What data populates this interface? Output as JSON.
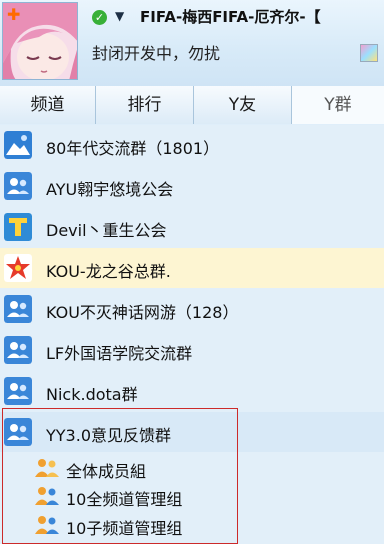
{
  "header": {
    "nickname": "FIFA-梅西FIFA-厄齐尔-【",
    "signature": "封闭开发中，勿扰",
    "status_icon": "online-check-icon",
    "colors": {
      "status_online": "#38b038",
      "accent_plus": "#ff6a00"
    }
  },
  "tabs": [
    {
      "label": "频道"
    },
    {
      "label": "排行"
    },
    {
      "label": "Y友"
    },
    {
      "label": "Y群"
    }
  ],
  "groups": [
    {
      "name": "80年代交流群（1801）",
      "icon": "group-icon-blue"
    },
    {
      "name": "AYU翱宇悠境公会",
      "icon": "people-icon"
    },
    {
      "name": "Devil丶重生公会",
      "icon": "guild-icon"
    },
    {
      "name": "KOU-龙之谷总群.",
      "icon": "star-group-icon"
    },
    {
      "name": "KOU不灭神话网游（128）",
      "icon": "people-icon"
    },
    {
      "name": "LF外国语学院交流群",
      "icon": "people-icon"
    },
    {
      "name": "Nick.dota群",
      "icon": "people-icon"
    },
    {
      "name": "YY3.0意见反馈群",
      "icon": "people-icon"
    }
  ],
  "subgroups": [
    {
      "name": "全体成员組"
    },
    {
      "name": "10全频道管理组"
    },
    {
      "name": "10子频道管理组"
    }
  ],
  "colors": {
    "highlight_row": "#fdf5d2",
    "selection_border": "#cc2a2a"
  }
}
